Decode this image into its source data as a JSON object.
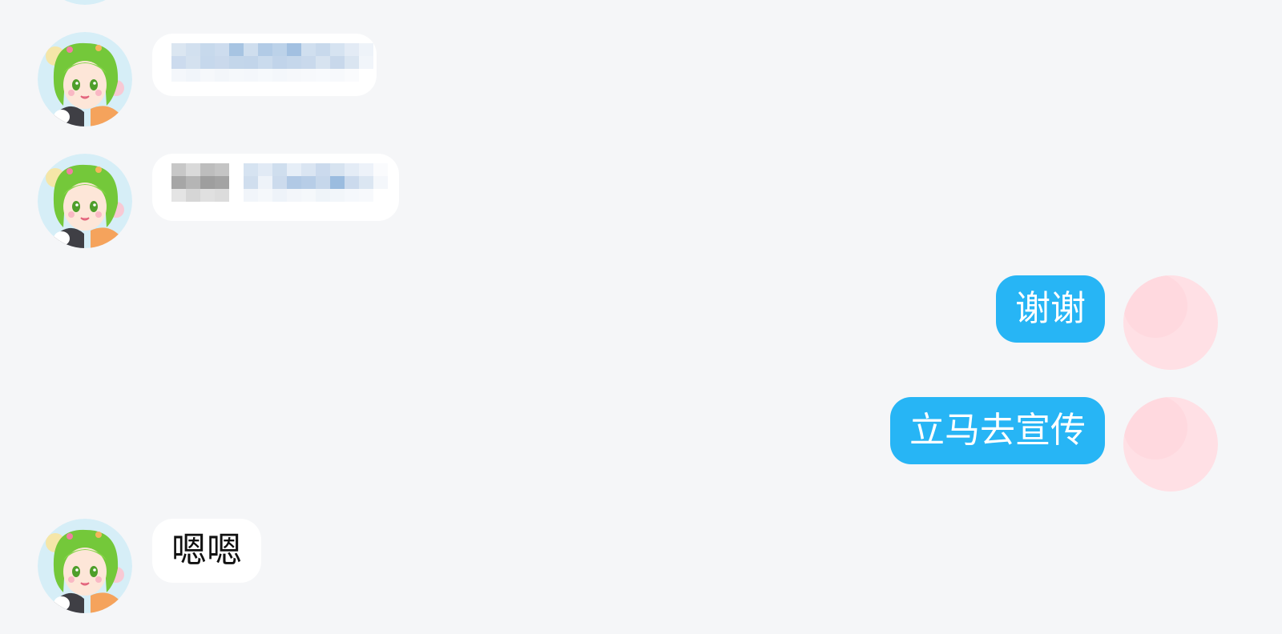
{
  "messages": [
    {
      "from": "them",
      "text": "",
      "blurred": true
    },
    {
      "from": "them",
      "text": "",
      "blurred": true
    },
    {
      "from": "me",
      "text": "谢谢"
    },
    {
      "from": "me",
      "text": "立马去宣传"
    },
    {
      "from": "them",
      "text": "嗯嗯"
    }
  ],
  "colors": {
    "background": "#f5f6f8",
    "incoming_bubble": "#ffffff",
    "outgoing_bubble": "#27b5f5",
    "outgoing_text": "#ffffff",
    "incoming_text": "#111111"
  },
  "avatars": {
    "them_icon": "anime-girl-avatar-icon",
    "me_icon": "pink-avatar-icon"
  }
}
